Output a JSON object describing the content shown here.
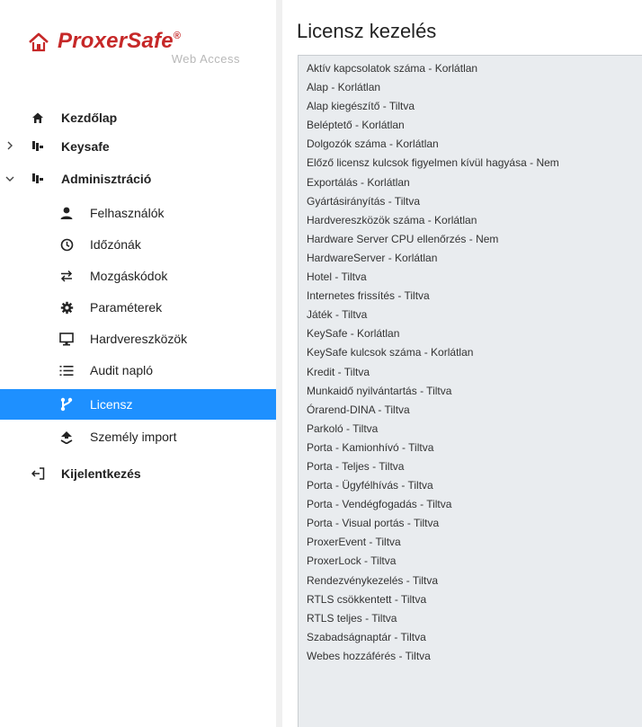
{
  "logo": {
    "brand": "ProxerSafe",
    "registered": "®",
    "subtitle": "Web Access"
  },
  "sidebar": {
    "items": [
      {
        "label": "Kezdőlap",
        "icon": "home-icon"
      },
      {
        "label": "Keysafe",
        "icon": "keysafe-icon",
        "expander": "›"
      },
      {
        "label": "Adminisztráció",
        "icon": "admin-icon",
        "expander": "⌄"
      }
    ],
    "subitems": [
      {
        "label": "Felhasználók",
        "icon": "user-icon"
      },
      {
        "label": "Időzónák",
        "icon": "clock-icon"
      },
      {
        "label": "Mozgáskódok",
        "icon": "exchange-icon"
      },
      {
        "label": "Paraméterek",
        "icon": "gear-icon"
      },
      {
        "label": "Hardvereszközök",
        "icon": "monitor-icon"
      },
      {
        "label": "Audit napló",
        "icon": "list-icon"
      },
      {
        "label": "Licensz",
        "icon": "branch-icon",
        "active": true
      },
      {
        "label": "Személy import",
        "icon": "import-icon"
      }
    ],
    "logout": {
      "label": "Kijelentkezés",
      "icon": "logout-icon"
    }
  },
  "colors": {
    "brand_red": "#c62828",
    "active_blue": "#1e90ff",
    "license_bg": "#e9ecef"
  },
  "main": {
    "title": "Licensz kezelés",
    "licenses": [
      "Aktív kapcsolatok száma - Korlátlan",
      "Alap - Korlátlan",
      "Alap kiegészítő - Tiltva",
      "Beléptető - Korlátlan",
      "Dolgozók száma - Korlátlan",
      "Előző licensz kulcsok figyelmen kívül hagyása - Nem",
      "Exportálás - Korlátlan",
      "Gyártásirányítás - Tiltva",
      "Hardvereszközök száma - Korlátlan",
      "Hardware Server CPU ellenőrzés - Nem",
      "HardwareServer - Korlátlan",
      "Hotel - Tiltva",
      "Internetes frissítés - Tiltva",
      "Játék - Tiltva",
      "KeySafe - Korlátlan",
      "KeySafe kulcsok száma - Korlátlan",
      "Kredit - Tiltva",
      "Munkaidő nyilvántartás - Tiltva",
      "Órarend-DINA - Tiltva",
      "Parkoló - Tiltva",
      "Porta - Kamionhívó - Tiltva",
      "Porta - Teljes - Tiltva",
      "Porta - Ügyfélhívás - Tiltva",
      "Porta - Vendégfogadás - Tiltva",
      "Porta - Visual portás - Tiltva",
      "ProxerEvent - Tiltva",
      "ProxerLock - Tiltva",
      "Rendezvénykezelés - Tiltva",
      "RTLS csökkentett - Tiltva",
      "RTLS teljes - Tiltva",
      "Szabadságnaptár - Tiltva",
      "Webes hozzáférés - Tiltva"
    ]
  }
}
